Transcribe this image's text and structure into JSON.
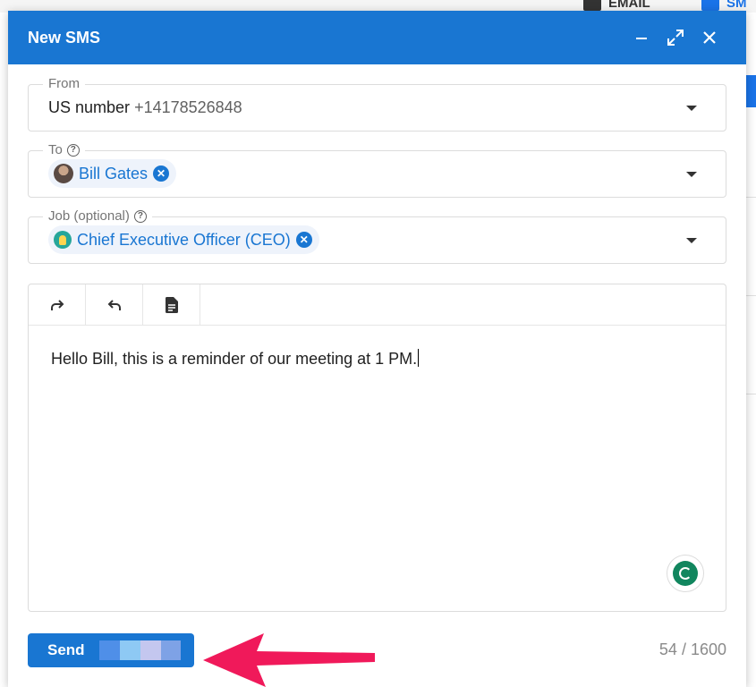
{
  "background": {
    "tab_email": "EMAIL",
    "tab_sms": "SM"
  },
  "dialog": {
    "title": "New SMS",
    "from": {
      "label": "From",
      "value_main": "US number",
      "value_number": "+14178526848"
    },
    "to": {
      "label": "To",
      "chip_label": "Bill Gates"
    },
    "job": {
      "label": "Job (optional)",
      "chip_label": "Chief Executive Officer (CEO)"
    },
    "message": "Hello Bill, this is a reminder of our meeting at 1 PM.",
    "send_label": "Send",
    "counter": "54 / 1600"
  },
  "colors": {
    "header_bg": "#1976d2",
    "accent": "#1976d2",
    "annotation_arrow": "#f0195a"
  }
}
